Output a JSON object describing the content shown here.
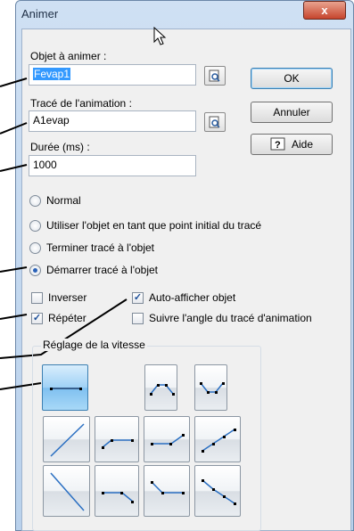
{
  "window": {
    "title": "Animer",
    "close_label": "x"
  },
  "object_field": {
    "label": "Objet à animer :",
    "value": "Fevap1"
  },
  "path_field": {
    "label": "Tracé de l'animation :",
    "value": "A1evap"
  },
  "duration_field": {
    "label": "Durée (ms) :",
    "value": "1000"
  },
  "buttons": {
    "ok": "OK",
    "cancel": "Annuler",
    "help": "Aide"
  },
  "radios": [
    {
      "label": "Normal",
      "checked": false
    },
    {
      "label": "Utiliser l'objet en tant que point initial du tracé",
      "checked": false
    },
    {
      "label": "Terminer tracé à l'objet",
      "checked": false
    },
    {
      "label": "Démarrer tracé à l'objet",
      "checked": true
    }
  ],
  "checkboxes": {
    "invert": {
      "label": "Inverser",
      "checked": false
    },
    "auto_show": {
      "label": "Auto-afficher objet",
      "checked": true
    },
    "repeat": {
      "label": "Répéter",
      "checked": true
    },
    "follow_angle": {
      "label": "Suivre l'angle du tracé d'animation",
      "checked": false
    }
  },
  "speed_group": {
    "label": "Réglage de la vitesse",
    "selected_index": 0
  }
}
